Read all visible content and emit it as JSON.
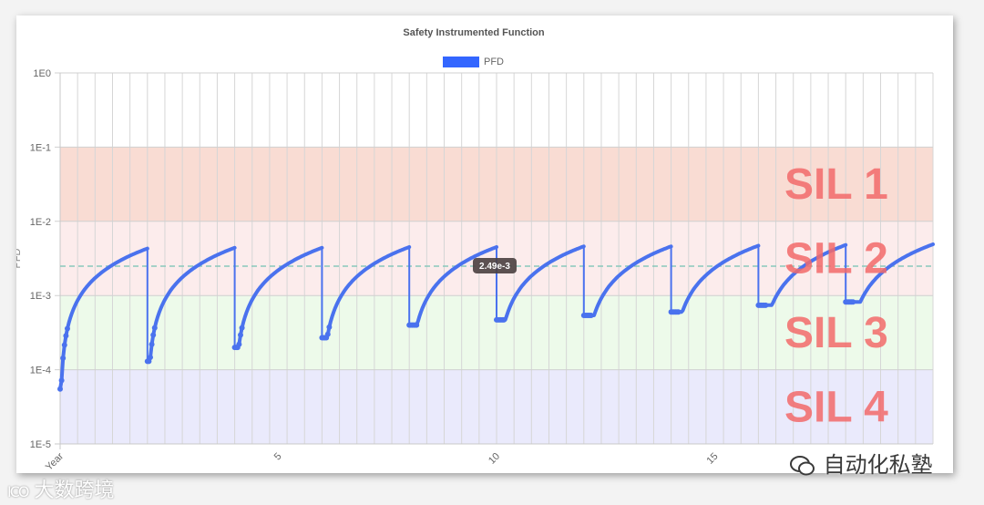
{
  "chart_data": {
    "type": "scatter",
    "title": "Safety Instrumented Function",
    "legend": {
      "position": "top-center",
      "entries": [
        {
          "label": "PFD",
          "color": "#3366ff"
        }
      ]
    },
    "y_scale": "log",
    "ylim": [
      1e-05,
      1
    ],
    "y_ticks": [
      "1E0",
      "1E-1",
      "1E-2",
      "1E-3",
      "1E-4",
      "1E-5"
    ],
    "ylabel": "PFD",
    "xlim": [
      0,
      20
    ],
    "x_ticks": [
      {
        "value": 0,
        "label": "Year"
      },
      {
        "value": 5,
        "label": "5"
      },
      {
        "value": 10,
        "label": "10"
      },
      {
        "value": 15,
        "label": "15"
      }
    ],
    "grid": true,
    "reference_line": {
      "value": 0.00249,
      "label": "2.49e-3",
      "style": "dashed",
      "color": "#88c8bb"
    },
    "bands": [
      {
        "label": "SIL 1",
        "from": 0.01,
        "to": 0.1,
        "color": "#f9dcd3"
      },
      {
        "label": "SIL 2",
        "from": 0.001,
        "to": 0.01,
        "color": "#fcecec"
      },
      {
        "label": "SIL 3",
        "from": 0.0001,
        "to": 0.001,
        "color": "#edfaea"
      },
      {
        "label": "SIL 4",
        "from": 1e-05,
        "to": 0.0001,
        "color": "#eaeafc"
      }
    ],
    "band_label_color": "#f26a6a",
    "series": [
      {
        "name": "PFD",
        "color": "#4a72ee",
        "cycles": [
          {
            "x_start": 0.0,
            "x_end": 2.0,
            "y_start": 5.5e-05,
            "y_end": 0.0043
          },
          {
            "x_start": 2.0,
            "x_end": 4.0,
            "y_start": 0.00013,
            "y_end": 0.0044
          },
          {
            "x_start": 4.0,
            "x_end": 6.0,
            "y_start": 0.0002,
            "y_end": 0.0044
          },
          {
            "x_start": 6.0,
            "x_end": 8.0,
            "y_start": 0.00027,
            "y_end": 0.0045
          },
          {
            "x_start": 8.0,
            "x_end": 10.0,
            "y_start": 0.0004,
            "y_end": 0.0045
          },
          {
            "x_start": 10.0,
            "x_end": 12.0,
            "y_start": 0.00047,
            "y_end": 0.0046
          },
          {
            "x_start": 12.0,
            "x_end": 14.0,
            "y_start": 0.00054,
            "y_end": 0.0046
          },
          {
            "x_start": 14.0,
            "x_end": 16.0,
            "y_start": 0.0006,
            "y_end": 0.0047
          },
          {
            "x_start": 16.0,
            "x_end": 18.0,
            "y_start": 0.00074,
            "y_end": 0.0048
          },
          {
            "x_start": 18.0,
            "x_end": 20.0,
            "y_start": 0.00082,
            "y_end": 0.0049
          }
        ]
      }
    ]
  },
  "watermark_right": "自动化私塾",
  "watermark_left": "大数跨境",
  "watermark_left_logo": "ICO"
}
